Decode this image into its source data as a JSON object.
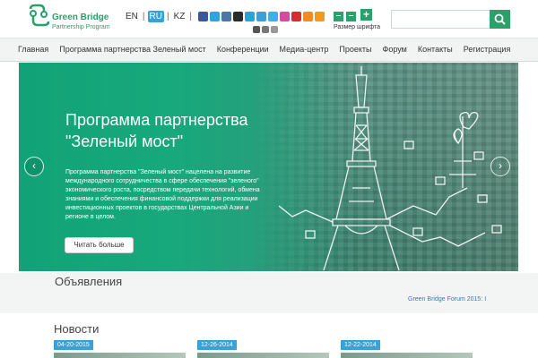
{
  "header": {
    "logo_title": "Green Bridge",
    "logo_subtitle": "Partnership Program",
    "languages": [
      {
        "code": "EN",
        "active": false
      },
      {
        "code": "RU",
        "active": true
      },
      {
        "code": "KZ",
        "active": false
      }
    ],
    "social_icons": [
      {
        "name": "facebook-icon",
        "color": "#3b5998"
      },
      {
        "name": "twitter-icon",
        "color": "#33a3e0"
      },
      {
        "name": "vkontakte-icon",
        "color": "#4a76a8"
      },
      {
        "name": "odnoklassniki-icon",
        "color": "#2b2b2b"
      },
      {
        "name": "livejournal-icon",
        "color": "#29a3d6"
      },
      {
        "name": "mail-icon",
        "color": "#3aa0d8"
      },
      {
        "name": "skype-icon",
        "color": "#3ab2e8"
      },
      {
        "name": "itunes-icon",
        "color": "#d84aa0"
      },
      {
        "name": "youtube-icon",
        "color": "#d62e2e"
      },
      {
        "name": "chat-icon",
        "color": "#f08a24"
      },
      {
        "name": "rss-icon",
        "color": "#f39a1e"
      }
    ],
    "social_icons_row2": [
      {
        "name": "print-icon",
        "color": "#555555"
      },
      {
        "name": "sound-icon",
        "color": "#777777"
      },
      {
        "name": "share-icon",
        "color": "#999999"
      }
    ],
    "font_size_label": "Размер шрифта",
    "font_decrease": "–",
    "font_normal": "–",
    "font_increase": "+",
    "search_placeholder": ""
  },
  "nav": {
    "items": [
      "Главная",
      "Программа партнерства Зеленый мост",
      "Конференции",
      "Медиа-центр",
      "Проекты",
      "Форум",
      "Контакты",
      "Регистрация"
    ]
  },
  "hero": {
    "title": "Программа партнерства \"Зеленый мост\"",
    "text": "Программа партнерства \"Зеленый мост\" нацелена на развитие международного сотрудничества в сфере обеспечения \"зеленого\" экономического роста, посредством передачи технологий, обмена знаниями и обеспечения финансовой поддержки для реализации инвестиционных проектов в государствах Центральной Азии и регионе в целом.",
    "read_more": "Читать больше",
    "prev": "‹",
    "next": "›"
  },
  "announcements": {
    "title": "Объявления",
    "ticker": "Green Bridge Forum 2015: I"
  },
  "news": {
    "title": "Новости",
    "items": [
      {
        "date": "04-20-2015"
      },
      {
        "date": "12-26-2014"
      },
      {
        "date": "12-22-2014"
      }
    ]
  },
  "colors": {
    "brand_green": "#2aa06a",
    "lang_active": "#3aa0d8",
    "hero_green": "#17a87c"
  }
}
